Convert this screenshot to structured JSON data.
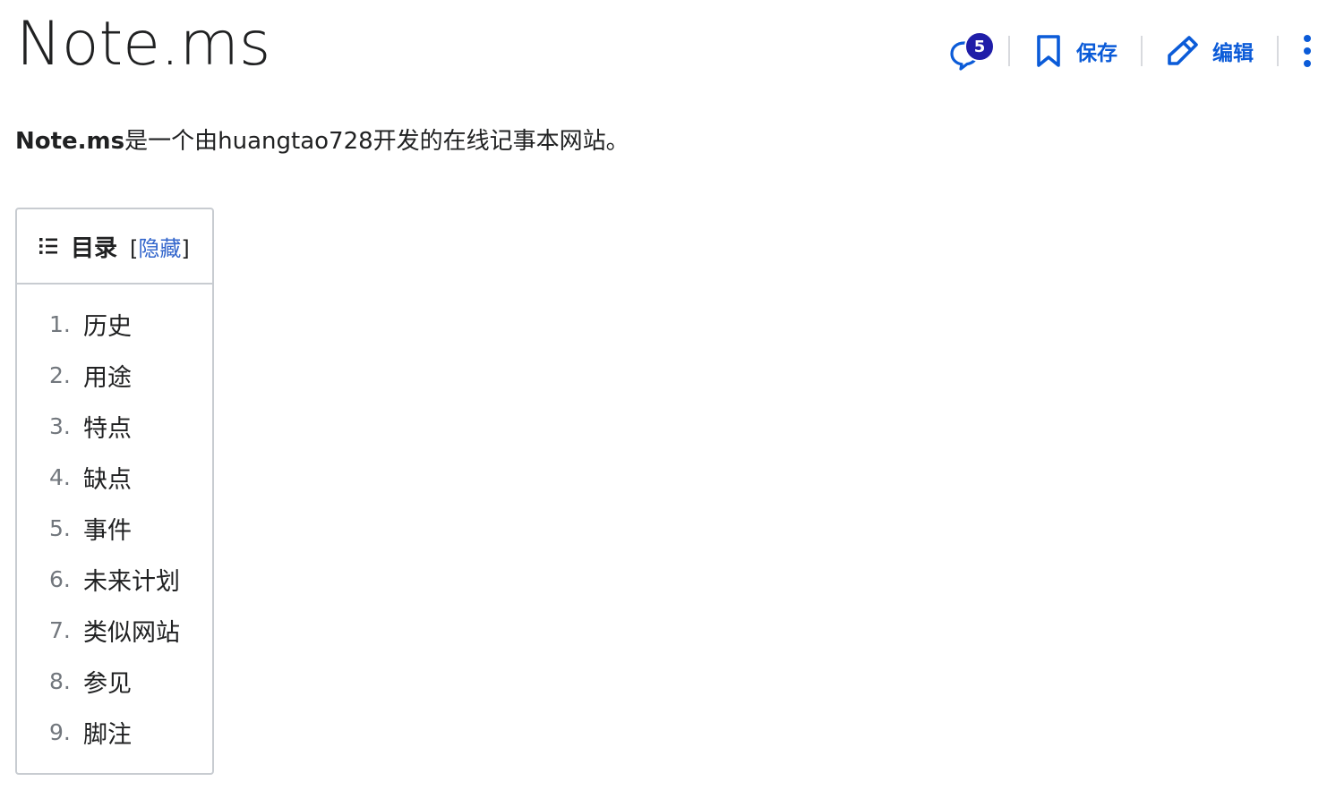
{
  "page": {
    "title": "Note.ms"
  },
  "toolbar": {
    "talk_count": "5",
    "save_label": "保存",
    "edit_label": "编辑"
  },
  "lead": {
    "bold_text": "Note.ms",
    "rest_text": "是一个由huangtao728开发的在线记事本网站。"
  },
  "toc": {
    "title": "目录",
    "bracket_open": "[",
    "toggle_label": "隐藏",
    "bracket_close": "]",
    "items": [
      {
        "number": "1.",
        "label": "历史"
      },
      {
        "number": "2.",
        "label": "用途"
      },
      {
        "number": "3.",
        "label": "特点"
      },
      {
        "number": "4.",
        "label": "缺点"
      },
      {
        "number": "5.",
        "label": "事件"
      },
      {
        "number": "6.",
        "label": "未来计划"
      },
      {
        "number": "7.",
        "label": "类似网站"
      },
      {
        "number": "8.",
        "label": "参见"
      },
      {
        "number": "9.",
        "label": "脚注"
      }
    ]
  },
  "colors": {
    "accent": "#0b5bd8",
    "badge": "#1f1da8",
    "link": "#3366cc",
    "border": "#c8ccd1"
  }
}
